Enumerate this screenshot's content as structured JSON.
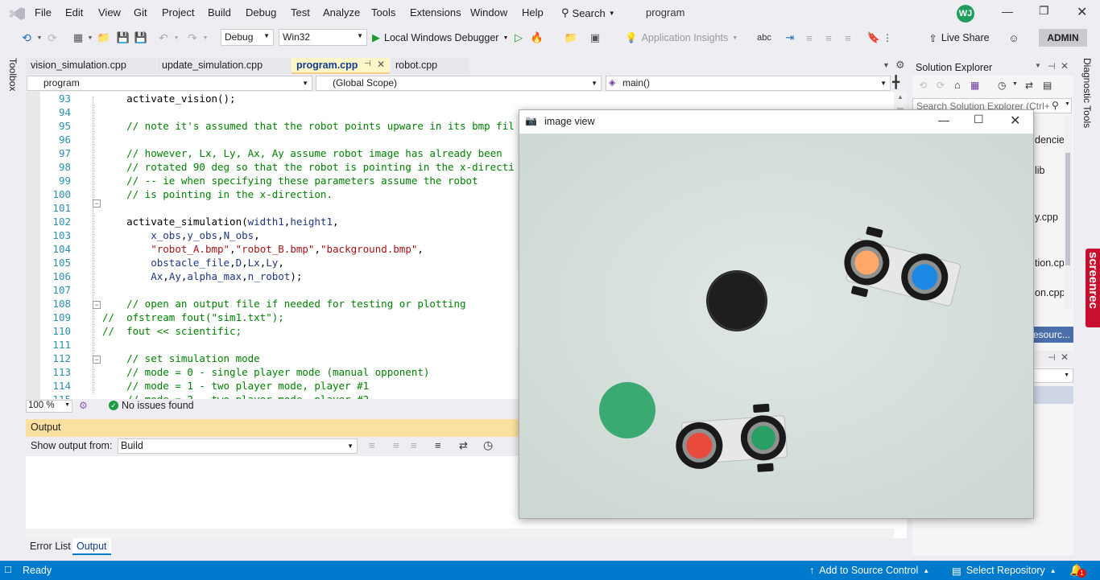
{
  "menubar": {
    "items": [
      "File",
      "Edit",
      "View",
      "Git",
      "Project",
      "Build",
      "Debug",
      "Test",
      "Analyze",
      "Tools",
      "Extensions",
      "Window",
      "Help"
    ],
    "search_label": "Search",
    "solution_name": "program",
    "user_initials": "WJ"
  },
  "toolbar": {
    "config": "Debug",
    "platform": "Win32",
    "run_label": "Local Windows Debugger",
    "insights_label": "Application Insights",
    "liveshare_label": "Live Share",
    "admin_label": "ADMIN"
  },
  "side_panels": {
    "toolbox": "Toolbox",
    "diagnostic": "Diagnostic Tools",
    "screenrec": "screenrec"
  },
  "tabs": [
    {
      "label": "vision_simulation.cpp"
    },
    {
      "label": "update_simulation.cpp"
    },
    {
      "label": "program.cpp"
    },
    {
      "label": "robot.cpp"
    }
  ],
  "navbar": {
    "project": "program",
    "scope": "(Global Scope)",
    "member": "main()"
  },
  "code_lines": [
    {
      "n": "93",
      "segs": [
        [
          "",
          "\tactivate_vision();"
        ]
      ]
    },
    {
      "n": "94",
      "segs": [
        [
          "",
          ""
        ]
      ]
    },
    {
      "n": "95",
      "segs": [
        [
          "cmt",
          "\t// note it's assumed that the robot points upware in its bmp fil"
        ]
      ]
    },
    {
      "n": "96",
      "segs": [
        [
          "",
          ""
        ]
      ]
    },
    {
      "n": "97",
      "segs": [
        [
          "cmt",
          "\t// however, Lx, Ly, Ax, Ay assume robot image has already been"
        ]
      ]
    },
    {
      "n": "98",
      "segs": [
        [
          "cmt",
          "\t// rotated 90 deg so that the robot is pointing in the x-directi"
        ]
      ]
    },
    {
      "n": "99",
      "segs": [
        [
          "cmt",
          "\t// -- ie when specifying these parameters assume the robot"
        ]
      ]
    },
    {
      "n": "100",
      "segs": [
        [
          "cmt",
          "\t// is pointing in the x-direction."
        ]
      ]
    },
    {
      "n": "101",
      "segs": [
        [
          "",
          ""
        ]
      ]
    },
    {
      "n": "102",
      "segs": [
        [
          "",
          "\tactivate_simulation("
        ],
        [
          "id",
          "width1"
        ],
        [
          "",
          ","
        ],
        [
          "id",
          "height1"
        ],
        [
          "",
          ","
        ]
      ]
    },
    {
      "n": "103",
      "segs": [
        [
          "",
          "\t\t"
        ],
        [
          "id",
          "x_obs"
        ],
        [
          "",
          ","
        ],
        [
          "id",
          "y_obs"
        ],
        [
          "",
          ","
        ],
        [
          "id",
          "N_obs"
        ],
        [
          "",
          ","
        ]
      ]
    },
    {
      "n": "104",
      "segs": [
        [
          "",
          "\t\t"
        ],
        [
          "str",
          "\"robot_A.bmp\""
        ],
        [
          "",
          ","
        ],
        [
          "str",
          "\"robot_B.bmp\""
        ],
        [
          "",
          ","
        ],
        [
          "str",
          "\"background.bmp\""
        ],
        [
          "",
          ","
        ]
      ]
    },
    {
      "n": "105",
      "segs": [
        [
          "",
          "\t\t"
        ],
        [
          "id",
          "obstacle_file"
        ],
        [
          "",
          ","
        ],
        [
          "id",
          "D"
        ],
        [
          "",
          ","
        ],
        [
          "id",
          "Lx"
        ],
        [
          "",
          ","
        ],
        [
          "id",
          "Ly"
        ],
        [
          "",
          ","
        ]
      ]
    },
    {
      "n": "106",
      "segs": [
        [
          "",
          "\t\t"
        ],
        [
          "id",
          "Ax"
        ],
        [
          "",
          ","
        ],
        [
          "id",
          "Ay"
        ],
        [
          "",
          ","
        ],
        [
          "id",
          "alpha_max"
        ],
        [
          "",
          ","
        ],
        [
          "id",
          "n_robot"
        ],
        [
          "",
          ");"
        ]
      ]
    },
    {
      "n": "107",
      "segs": [
        [
          "",
          ""
        ]
      ]
    },
    {
      "n": "108",
      "segs": [
        [
          "cmt",
          "\t// open an output file if needed for testing or plotting"
        ]
      ]
    },
    {
      "n": "109",
      "segs": [
        [
          "cmt",
          "//\tofstream fout(\"sim1.txt\");"
        ]
      ]
    },
    {
      "n": "110",
      "segs": [
        [
          "cmt",
          "//\tfout << scientific;"
        ]
      ]
    },
    {
      "n": "111",
      "segs": [
        [
          "",
          ""
        ]
      ]
    },
    {
      "n": "112",
      "segs": [
        [
          "cmt",
          "\t// set simulation mode"
        ]
      ]
    },
    {
      "n": "113",
      "segs": [
        [
          "cmt",
          "\t// mode = 0 - single player mode (manual opponent)"
        ]
      ]
    },
    {
      "n": "114",
      "segs": [
        [
          "cmt",
          "\t// mode = 1 - two player mode, player #1"
        ]
      ]
    },
    {
      "n": "115",
      "segs": [
        [
          "cmt",
          "\t// mode = 2 - two player mode, player #2"
        ]
      ]
    }
  ],
  "editor_status": {
    "zoom": "100 %",
    "issues": "No issues found"
  },
  "output": {
    "title": "Output",
    "show_from_label": "Show output from:",
    "source": "Build"
  },
  "bottom_tabs": [
    "Error List",
    "Output"
  ],
  "statusbar": {
    "ready": "Ready",
    "source_control": "Add to Source Control",
    "repository": "Select Repository",
    "notifications": "1"
  },
  "solution_explorer": {
    "title": "Solution Explorer",
    "search_placeholder": "Search Solution Explorer (Ctrl+",
    "visible_items": [
      "dencie",
      "lib",
      "y.cpp",
      "tion.cp",
      "on.cpp",
      "esourc..."
    ]
  },
  "image_window": {
    "title": "image view"
  },
  "scene_colors": {
    "background": "#d8e1dd",
    "obstacle": "#1e1e20",
    "target": "#3aaa72",
    "robot_a_front": "#1e88e5",
    "robot_a_back": "#ffa868",
    "robot_b_front": "#2aa066",
    "robot_b_back": "#e84a3c"
  }
}
